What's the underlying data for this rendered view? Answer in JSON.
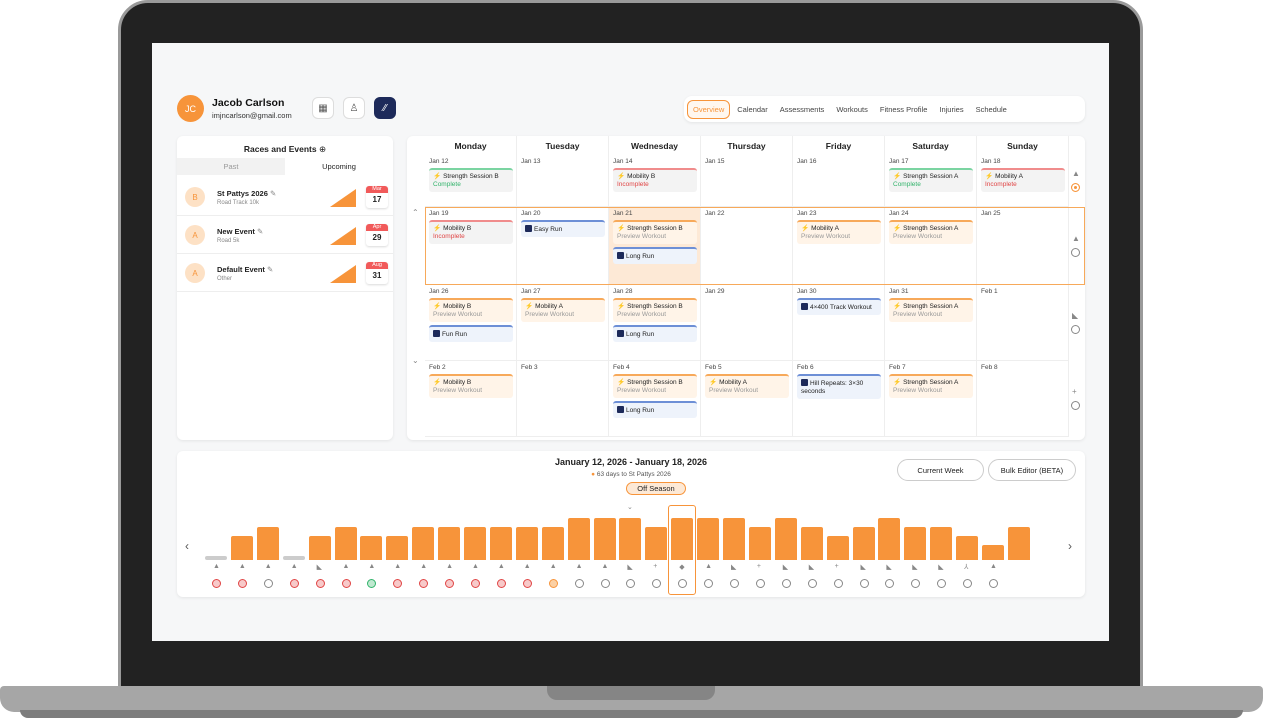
{
  "user": {
    "initials": "JC",
    "name": "Jacob Carlson",
    "email": "imjncarlson@gmail.com"
  },
  "nav": {
    "tabs": [
      "Overview",
      "Calendar",
      "Assessments",
      "Workouts",
      "Fitness Profile",
      "Injuries",
      "Schedule"
    ],
    "active": "Overview"
  },
  "races": {
    "title": "Races and Events",
    "tab_past": "Past",
    "tab_upcoming": "Upcoming",
    "events": [
      {
        "badge": "B",
        "name": "St Pattys 2026",
        "sub": "Road Track 10k",
        "tri": "2",
        "mon": "Mar",
        "day": "17"
      },
      {
        "badge": "A",
        "name": "New Event",
        "sub": "Road 5k",
        "tri": "3",
        "mon": "Apr",
        "day": "29"
      },
      {
        "badge": "A",
        "name": "Default Event",
        "sub": "Other",
        "tri": "3",
        "mon": "Aug",
        "day": "31"
      }
    ]
  },
  "calendar": {
    "days": [
      "Monday",
      "Tuesday",
      "Wednesday",
      "Thursday",
      "Friday",
      "Saturday",
      "Sunday"
    ],
    "weeks": [
      {
        "dates": [
          "Jan 12",
          "Jan 13",
          "Jan 14",
          "Jan 15",
          "Jan 16",
          "Jan 17",
          "Jan 18"
        ],
        "cells": [
          [
            {
              "name": "Strength Session B",
              "status": "Complete",
              "color": "green",
              "kind": "p"
            }
          ],
          [],
          [
            {
              "name": "Mobility B",
              "status": "Incomplete",
              "color": "red",
              "kind": "p"
            }
          ],
          [],
          [],
          [
            {
              "name": "Strength Session A",
              "status": "Complete",
              "color": "green",
              "kind": "p"
            }
          ],
          [
            {
              "name": "Mobility A",
              "status": "Incomplete",
              "color": "red",
              "kind": "p"
            }
          ]
        ]
      },
      {
        "dates": [
          "Jan 19",
          "Jan 20",
          "Jan 21",
          "Jan 22",
          "Jan 23",
          "Jan 24",
          "Jan 25"
        ],
        "cells": [
          [
            {
              "name": "Mobility B",
              "status": "Incomplete",
              "color": "red",
              "kind": "p"
            }
          ],
          [
            {
              "name": "Easy Run",
              "status": "",
              "color": "blue",
              "kind": "r"
            }
          ],
          [
            {
              "name": "Strength Session B",
              "status": "Preview Workout",
              "color": "orange",
              "kind": "p"
            },
            {
              "name": "Long Run",
              "status": "",
              "color": "blue",
              "kind": "r"
            }
          ],
          [],
          [
            {
              "name": "Mobility A",
              "status": "Preview Workout",
              "color": "orange",
              "kind": "p"
            }
          ],
          [
            {
              "name": "Strength Session A",
              "status": "Preview Workout",
              "color": "orange",
              "kind": "p"
            }
          ],
          []
        ]
      },
      {
        "dates": [
          "Jan 26",
          "Jan 27",
          "Jan 28",
          "Jan 29",
          "Jan 30",
          "Jan 31",
          "Feb 1"
        ],
        "cells": [
          [
            {
              "name": "Mobility B",
              "status": "Preview Workout",
              "color": "orange",
              "kind": "p"
            },
            {
              "name": "Fun Run",
              "status": "",
              "color": "blue",
              "kind": "r"
            }
          ],
          [
            {
              "name": "Mobility A",
              "status": "Preview Workout",
              "color": "orange",
              "kind": "p"
            }
          ],
          [
            {
              "name": "Strength Session B",
              "status": "Preview Workout",
              "color": "orange",
              "kind": "p"
            },
            {
              "name": "Long Run",
              "status": "",
              "color": "blue",
              "kind": "r"
            }
          ],
          [],
          [
            {
              "name": "4×400 Track Workout",
              "status": "",
              "color": "blue",
              "kind": "r"
            }
          ],
          [
            {
              "name": "Strength Session A",
              "status": "Preview Workout",
              "color": "orange",
              "kind": "p"
            }
          ],
          []
        ]
      },
      {
        "dates": [
          "Feb 2",
          "Feb 3",
          "Feb 4",
          "Feb 5",
          "Feb 6",
          "Feb 7",
          "Feb 8"
        ],
        "cells": [
          [
            {
              "name": "Mobility B",
              "status": "Preview Workout",
              "color": "orange",
              "kind": "p"
            }
          ],
          [],
          [
            {
              "name": "Strength Session B",
              "status": "Preview Workout",
              "color": "orange",
              "kind": "p"
            },
            {
              "name": "Long Run",
              "status": "",
              "color": "blue",
              "kind": "r"
            }
          ],
          [
            {
              "name": "Mobility A",
              "status": "Preview Workout",
              "color": "orange",
              "kind": "p"
            }
          ],
          [
            {
              "name": "Hill Repeats: 3×30 seconds",
              "status": "",
              "color": "blue",
              "kind": "r"
            }
          ],
          [
            {
              "name": "Strength Session A",
              "status": "Preview Workout",
              "color": "orange",
              "kind": "p"
            }
          ],
          []
        ]
      }
    ]
  },
  "plan": {
    "range": "January 12, 2026 - January 18, 2026",
    "days_to": "63 days to St Pattys 2026",
    "season": "Off Season",
    "current_week": "Current Week",
    "bulk_editor": "Bulk Editor (BETA)",
    "bars": [
      0,
      0.55,
      0.75,
      0,
      0.55,
      0.75,
      0.55,
      0.55,
      0.75,
      0.75,
      0.75,
      0.75,
      0.75,
      0.75,
      0.95,
      0.95,
      0.95,
      0.75,
      0.95,
      0.95,
      0.95,
      0.75,
      0.95,
      0.75,
      0.55,
      0.75,
      0.95,
      0.75,
      0.75,
      0.55,
      0.35,
      0.75
    ],
    "dots": [
      "red",
      "red",
      "",
      "red",
      "red",
      "red",
      "green",
      "red",
      "red",
      "red",
      "red",
      "red",
      "red",
      "orange",
      "",
      "",
      "",
      "",
      "",
      "",
      "",
      "",
      "",
      "",
      "",
      "",
      "",
      "",
      "",
      "",
      "",
      ""
    ]
  },
  "colors": {
    "accent": "#f7943a",
    "navy": "#1d2a5a",
    "complete": "#32b36b",
    "incomplete": "#e04646"
  }
}
